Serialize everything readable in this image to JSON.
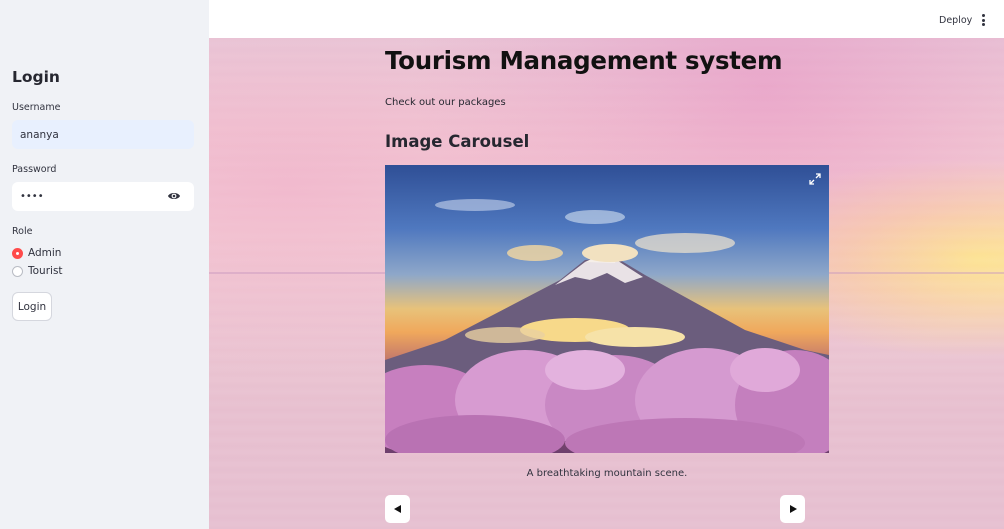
{
  "sidebar": {
    "title": "Login",
    "username": {
      "label": "Username",
      "value": "ananya"
    },
    "password": {
      "label": "Password",
      "value": "••••",
      "toggle_icon": "eye-icon"
    },
    "role": {
      "label": "Role",
      "options": [
        {
          "label": "Admin",
          "selected": true
        },
        {
          "label": "Tourist",
          "selected": false
        }
      ]
    },
    "login_button": "Login"
  },
  "header": {
    "deploy_label": "Deploy",
    "menu_icon": "vertical-ellipsis-icon"
  },
  "main": {
    "title": "Tourism Management system",
    "subtitle": "Check out our packages",
    "section_title": "Image Carousel",
    "carousel": {
      "caption": "A breathtaking mountain scene.",
      "expand_icon": "fullscreen-expand-icon",
      "prev_icon": "triangle-left-icon",
      "next_icon": "triangle-right-icon"
    }
  },
  "colors": {
    "accent": "#ff4b4b",
    "sidebar_bg": "#f0f2f6",
    "input_filled_bg": "#e8f0fe"
  }
}
